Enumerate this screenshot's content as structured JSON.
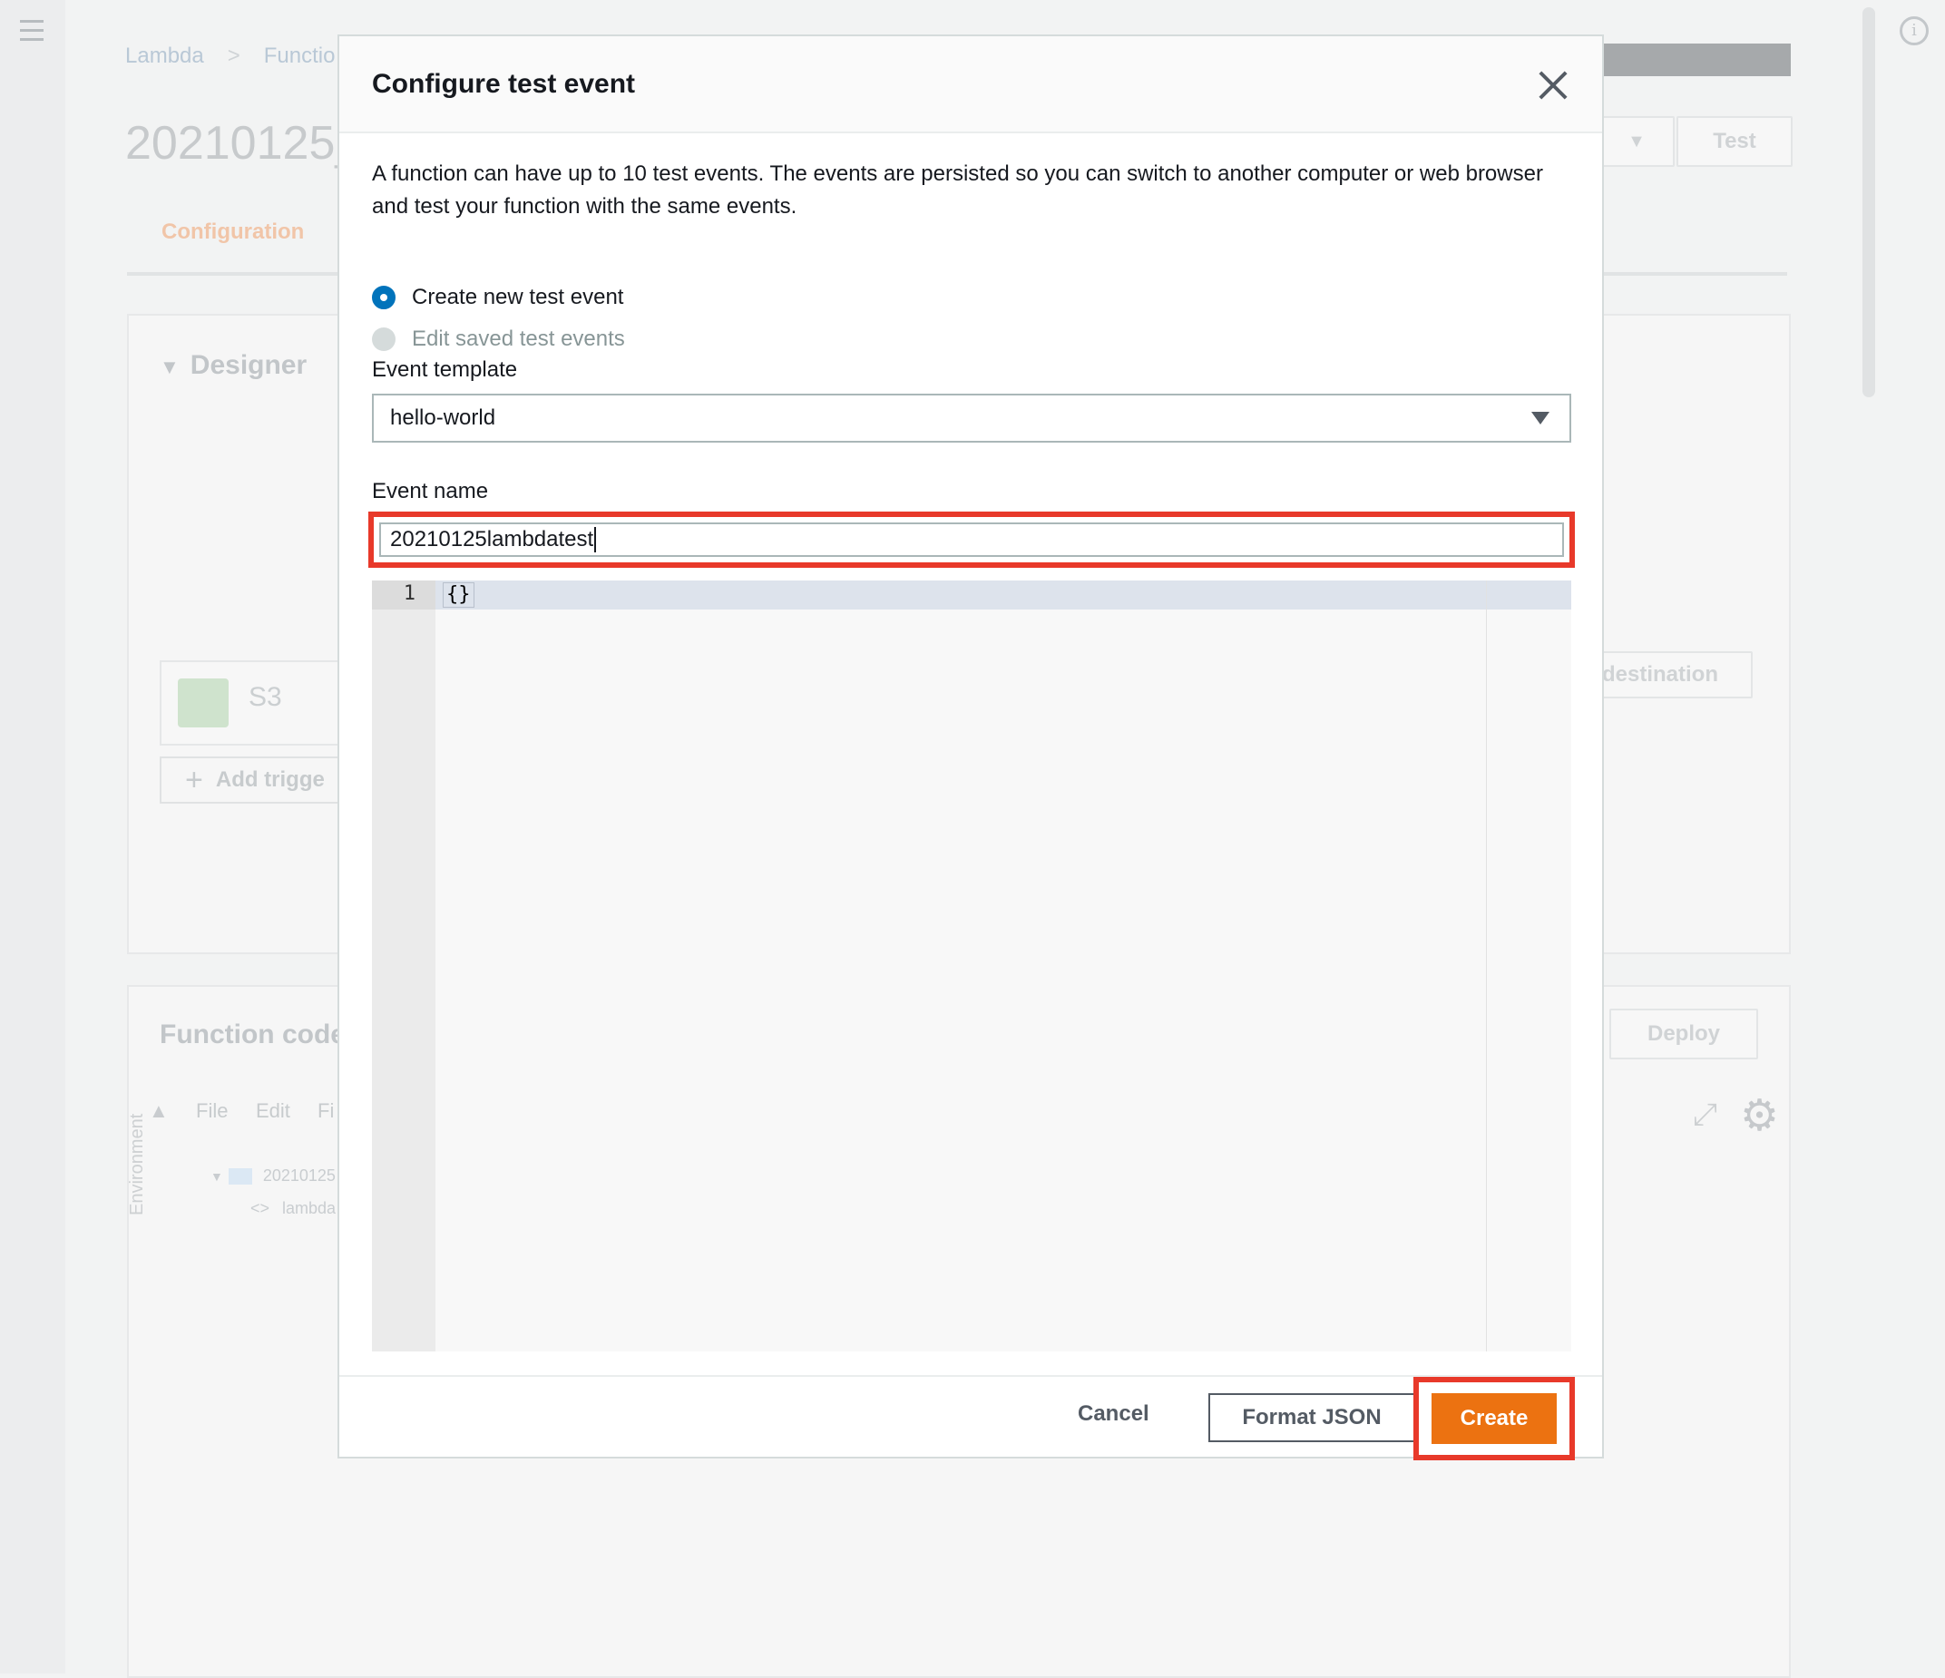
{
  "background": {
    "breadcrumb": [
      "Lambda",
      "Functio"
    ],
    "function_title": "20210125_",
    "tab_configuration": "Configuration",
    "test_button": "Test",
    "designer_title": "Designer",
    "s3_label": "S3",
    "add_trigger": "Add trigge",
    "add_destination": "destination",
    "function_code_title": "Function code",
    "deploy_button": "Deploy",
    "menu": [
      "File",
      "Edit",
      "Fi"
    ],
    "environment_label": "Environment",
    "tree_folder": "20210125",
    "tree_file": "lambda"
  },
  "modal": {
    "title": "Configure test event",
    "description": "A function can have up to 10 test events. The events are persisted so you can switch to another computer or web browser and test your function with the same events.",
    "radio_create": "Create new test event",
    "radio_edit": "Edit saved test events",
    "event_template_label": "Event template",
    "event_template_value": "hello-world",
    "event_name_label": "Event name",
    "event_name_value": "20210125lambdatest",
    "editor": {
      "line_number": "1",
      "code": "{}"
    },
    "cancel_label": "Cancel",
    "format_json_label": "Format JSON",
    "create_label": "Create"
  },
  "colors": {
    "accent_orange": "#ec7211",
    "highlight_red": "#e8392a",
    "radio_blue": "#0073bb"
  }
}
